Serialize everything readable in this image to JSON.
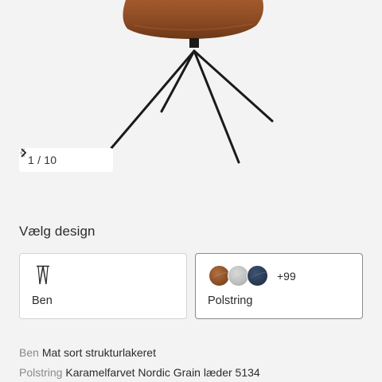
{
  "gallery": {
    "pager_text": "1 / 10",
    "prev_icon": "chevron-left-icon",
    "next_icon": "chevron-right-icon"
  },
  "design": {
    "title": "Vælg design",
    "options": [
      {
        "label": "Ben",
        "icon": "chair-legs-icon"
      },
      {
        "label": "Polstring",
        "more": "+99",
        "swatches": [
          "#8a4d25",
          "#bdbdbd",
          "#293a54"
        ]
      }
    ]
  },
  "specs": [
    {
      "key": "Ben",
      "value": "Mat sort strukturlakeret"
    },
    {
      "key": "Polstring",
      "value": "Karamelfarvet Nordic Grain læder 5134"
    }
  ],
  "colors": {
    "background": "#f3f3f3",
    "leather": "#8b4a23",
    "legs": "#1a1a1a"
  }
}
